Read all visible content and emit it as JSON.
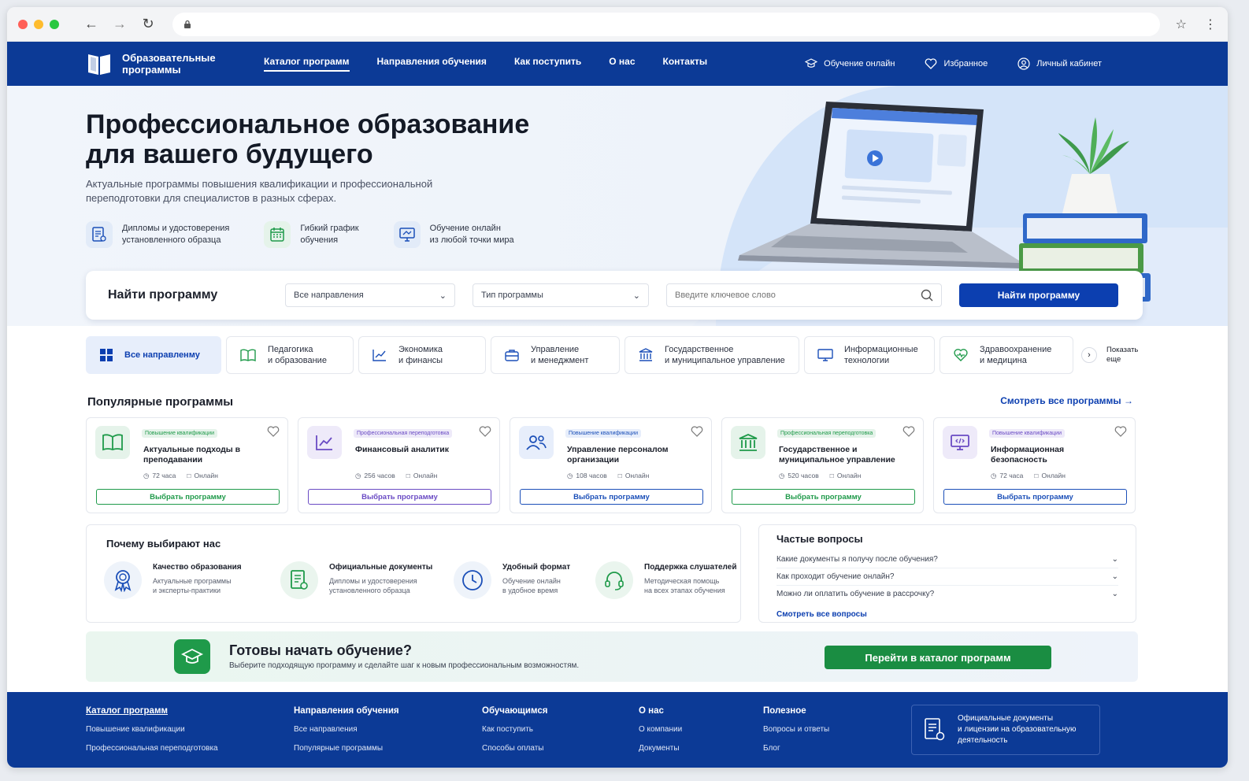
{
  "header": {
    "logo_line1": "Образовательные",
    "logo_line2": "программы",
    "nav": [
      "Каталог программ",
      "Направления обучения",
      "Как поступить",
      "О нас",
      "Контакты"
    ],
    "online": "Обучение онлайн",
    "favorites": "Избранное",
    "account": "Личный кабинет"
  },
  "hero": {
    "title_line1": "Профессиональное образование",
    "title_line2": "для вашего будущего",
    "subtitle": "Актуальные программы повышения квалификации и профессиональной переподготовки для специалистов в разных сферах.",
    "features": [
      {
        "line1": "Дипломы и удостоверения",
        "line2": "установленного образца",
        "icon": "diploma-icon"
      },
      {
        "line1": "Гибкий график",
        "line2": "обучения",
        "icon": "calendar-icon"
      },
      {
        "line1": "Обучение онлайн",
        "line2": "из любой точки мира",
        "icon": "monitor-icon"
      }
    ]
  },
  "search": {
    "title": "Найти программу",
    "direction": "Все направления",
    "type": "Тип программы",
    "placeholder": "Введите ключевое слово",
    "button": "Найти программу"
  },
  "categories": [
    {
      "line1": "Все направленму",
      "line2": ""
    },
    {
      "line1": "Педагогика",
      "line2": "и образование"
    },
    {
      "line1": "Экономика",
      "line2": "и финансы"
    },
    {
      "line1": "Управление",
      "line2": "и менеджмент"
    },
    {
      "line1": "Государственное",
      "line2": "и муниципальное управление"
    },
    {
      "line1": "Информационные",
      "line2": "технологии"
    },
    {
      "line1": "Здравоохранение",
      "line2": "и медицина"
    }
  ],
  "categories_more": {
    "line1": "Показать",
    "line2": "еще"
  },
  "popular": {
    "title": "Популярные программы",
    "see_all": "Смотреть все программы",
    "cards": [
      {
        "badge": "Повышение квалификации",
        "title": "Актуальные подходы в преподавании",
        "hours": "72 часа",
        "format": "Онлайн",
        "button": "Выбрать программу"
      },
      {
        "badge": "Профессиональная переподготовка",
        "title": "Финансовый аналитик",
        "hours": "256 часов",
        "format": "Онлайн",
        "button": "Выбрать программу"
      },
      {
        "badge": "Повышение квалификации",
        "title": "Управление персоналом организации",
        "hours": "108 часов",
        "format": "Онлайн",
        "button": "Выбрать программу"
      },
      {
        "badge": "Профессиональная переподготовка",
        "title": "Государственное и муниципальное управление",
        "hours": "520 часов",
        "format": "Онлайн",
        "button": "Выбрать программу"
      },
      {
        "badge": "Повышение квалификации",
        "title": "Информационная безопасность",
        "hours": "72 часа",
        "format": "Онлайн",
        "button": "Выбрать программу"
      }
    ]
  },
  "why": {
    "title": "Почему выбирают нас",
    "items": [
      {
        "title": "Качество образования",
        "line1": "Актуальные программы",
        "line2": "и эксперты-практики"
      },
      {
        "title": "Официальные документы",
        "line1": "Дипломы и удостоверения",
        "line2": "установленного образца"
      },
      {
        "title": "Удобный формат",
        "line1": "Обучение онлайн",
        "line2": "в удобное время"
      },
      {
        "title": "Поддержка слушателей",
        "line1": "Методическая помощь",
        "line2": "на всех этапах обучения"
      }
    ]
  },
  "faq": {
    "title": "Частые вопросы",
    "items": [
      "Какие документы я получу после обучения?",
      "Как проходит обучение онлайн?",
      "Можно ли оплатить обучение в рассрочку?"
    ],
    "see_all": "Смотреть все вопросы"
  },
  "cta": {
    "title": "Готовы начать обучение?",
    "subtitle": "Выберите подходящую программу и сделайте шаг к новым профессиональным возможностям.",
    "button": "Перейти в каталог программ"
  },
  "footer": {
    "cols": [
      {
        "head": "Каталог программ",
        "links": [
          "Повышение квалификации",
          "Профессиональная переподготовка"
        ]
      },
      {
        "head": "Направления обучения",
        "links": [
          "Все направления",
          "Популярные программы"
        ]
      },
      {
        "head": "Обучающимся",
        "links": [
          "Как поступить",
          "Способы оплаты"
        ]
      },
      {
        "head": "О нас",
        "links": [
          "О компании",
          "Документы"
        ]
      },
      {
        "head": "Полезное",
        "links": [
          "Вопросы и ответы",
          "Блог"
        ]
      }
    ],
    "docs_line1": "Официальные документы",
    "docs_line2": "и лицензии на образовательную",
    "docs_line3": "деятельность"
  },
  "colors": {
    "brand": "#0c3a96",
    "accent": "#0c3fb0",
    "green": "#1a8d42",
    "purple": "#6a4bc4"
  }
}
